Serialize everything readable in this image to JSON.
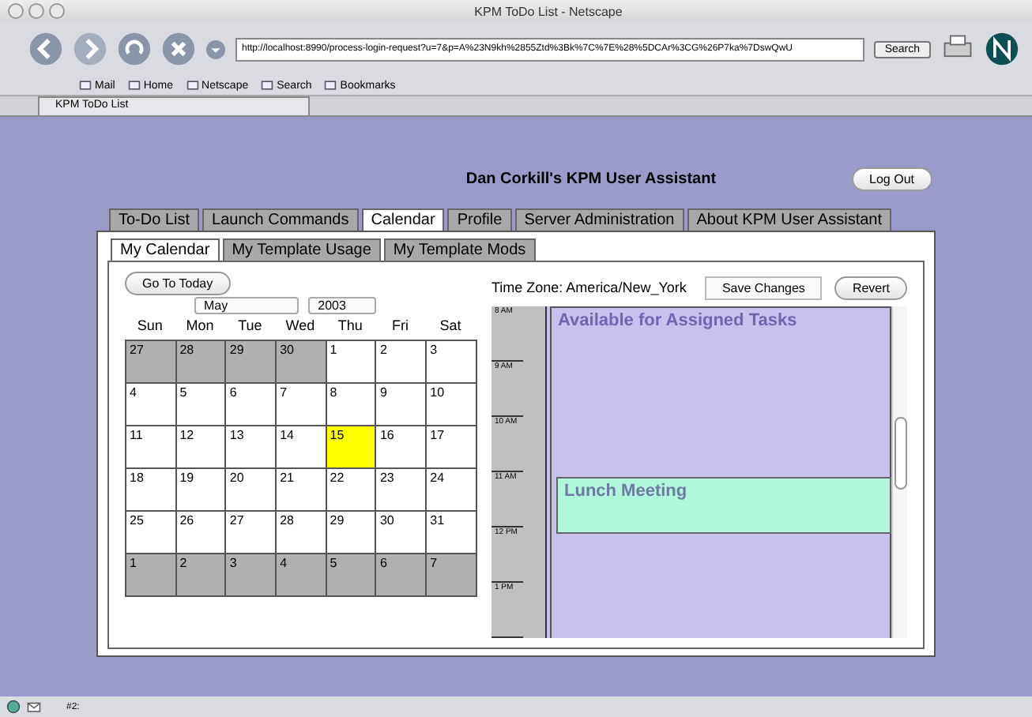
{
  "window": {
    "title": "KPM ToDo List - Netscape"
  },
  "toolbar": {
    "url": "http://localhost:8990/process-login-request?u=7&p=A%23N9kh%2855Ztd%3Bk%7C%7E%28%5DCAr%3CG%26P7ka%7DswQwU",
    "search_button": "Search"
  },
  "personal_bar": [
    {
      "label": "Mail"
    },
    {
      "label": "Home"
    },
    {
      "label": "Netscape"
    },
    {
      "label": "Search"
    },
    {
      "label": "Bookmarks"
    }
  ],
  "browser_tab": {
    "title": "KPM ToDo List"
  },
  "page": {
    "heading": "Dan Corkill's KPM User Assistant",
    "logout": "Log Out",
    "tabs": [
      {
        "label": "To-Do List",
        "selected": false
      },
      {
        "label": "Launch Commands",
        "selected": false
      },
      {
        "label": "Calendar",
        "selected": true
      },
      {
        "label": "Profile",
        "selected": false
      },
      {
        "label": "Server Administration",
        "selected": false
      },
      {
        "label": "About KPM User Assistant",
        "selected": false
      }
    ],
    "subtabs": [
      {
        "label": "My Calendar",
        "selected": true
      },
      {
        "label": "My Template Usage",
        "selected": false
      },
      {
        "label": "My Template Mods",
        "selected": false
      }
    ],
    "go_today": "Go To Today",
    "month": "May",
    "year": "2003",
    "weekdays": [
      "Sun",
      "Mon",
      "Tue",
      "Wed",
      "Thu",
      "Fri",
      "Sat"
    ],
    "weeks": [
      [
        {
          "day": "27",
          "in_month": false,
          "selected": false
        },
        {
          "day": "28",
          "in_month": false,
          "selected": false
        },
        {
          "day": "29",
          "in_month": false,
          "selected": false
        },
        {
          "day": "30",
          "in_month": false,
          "selected": false
        },
        {
          "day": "1",
          "in_month": true,
          "selected": false
        },
        {
          "day": "2",
          "in_month": true,
          "selected": false
        },
        {
          "day": "3",
          "in_month": true,
          "selected": false
        }
      ],
      [
        {
          "day": "4",
          "in_month": true,
          "selected": false
        },
        {
          "day": "5",
          "in_month": true,
          "selected": false
        },
        {
          "day": "6",
          "in_month": true,
          "selected": false
        },
        {
          "day": "7",
          "in_month": true,
          "selected": false
        },
        {
          "day": "8",
          "in_month": true,
          "selected": false
        },
        {
          "day": "9",
          "in_month": true,
          "selected": false
        },
        {
          "day": "10",
          "in_month": true,
          "selected": false
        }
      ],
      [
        {
          "day": "11",
          "in_month": true,
          "selected": false
        },
        {
          "day": "12",
          "in_month": true,
          "selected": false
        },
        {
          "day": "13",
          "in_month": true,
          "selected": false
        },
        {
          "day": "14",
          "in_month": true,
          "selected": false
        },
        {
          "day": "15",
          "in_month": true,
          "selected": true
        },
        {
          "day": "16",
          "in_month": true,
          "selected": false
        },
        {
          "day": "17",
          "in_month": true,
          "selected": false
        }
      ],
      [
        {
          "day": "18",
          "in_month": true,
          "selected": false
        },
        {
          "day": "19",
          "in_month": true,
          "selected": false
        },
        {
          "day": "20",
          "in_month": true,
          "selected": false
        },
        {
          "day": "21",
          "in_month": true,
          "selected": false
        },
        {
          "day": "22",
          "in_month": true,
          "selected": false
        },
        {
          "day": "23",
          "in_month": true,
          "selected": false
        },
        {
          "day": "24",
          "in_month": true,
          "selected": false
        }
      ],
      [
        {
          "day": "25",
          "in_month": true,
          "selected": false
        },
        {
          "day": "26",
          "in_month": true,
          "selected": false
        },
        {
          "day": "27",
          "in_month": true,
          "selected": false
        },
        {
          "day": "28",
          "in_month": true,
          "selected": false
        },
        {
          "day": "29",
          "in_month": true,
          "selected": false
        },
        {
          "day": "30",
          "in_month": true,
          "selected": false
        },
        {
          "day": "31",
          "in_month": true,
          "selected": false
        }
      ],
      [
        {
          "day": "1",
          "in_month": false,
          "selected": false
        },
        {
          "day": "2",
          "in_month": false,
          "selected": false
        },
        {
          "day": "3",
          "in_month": false,
          "selected": false
        },
        {
          "day": "4",
          "in_month": false,
          "selected": false
        },
        {
          "day": "5",
          "in_month": false,
          "selected": false
        },
        {
          "day": "6",
          "in_month": false,
          "selected": false
        },
        {
          "day": "7",
          "in_month": false,
          "selected": false
        }
      ]
    ],
    "timezone": "Time Zone: America/New_York",
    "save": "Save Changes",
    "revert": "Revert",
    "hours": [
      "8 AM",
      "9 AM",
      "10 AM",
      "11 AM",
      "12 PM",
      "1 PM"
    ],
    "events": [
      {
        "title": "Available for Assigned Tasks",
        "kind": "availability",
        "color": "#c9c0ee"
      },
      {
        "title": "Lunch Meeting",
        "kind": "meeting",
        "color": "#b0f7db"
      }
    ]
  },
  "status_bar": {
    "text": "#2:"
  }
}
